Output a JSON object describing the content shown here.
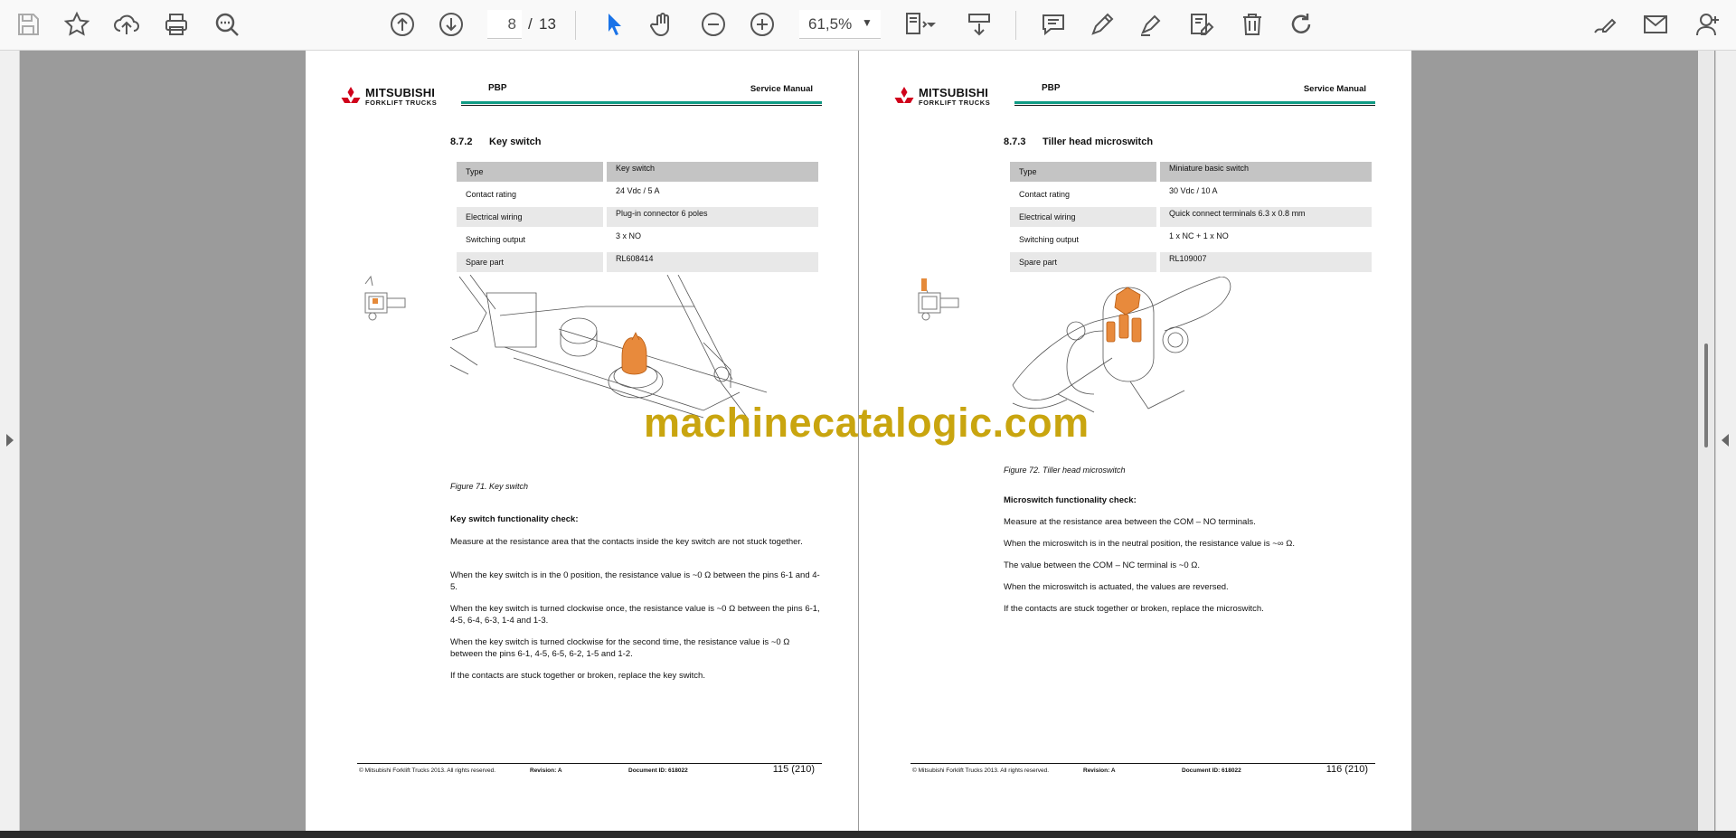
{
  "toolbar": {
    "current_page": "8",
    "page_sep": "/",
    "total_pages": "13",
    "zoom": "61,5%",
    "icons": [
      "save-icon",
      "bookmark-star-icon",
      "upload-cloud-icon",
      "print-icon",
      "zoom-search-icon",
      "prev-page-icon",
      "next-page-icon",
      "select-cursor-icon",
      "hand-tool-icon",
      "zoom-out-icon",
      "zoom-in-icon",
      "zoom-dropdown-icon",
      "fit-page-icon",
      "scroll-mode-icon",
      "comment-icon",
      "pen-icon",
      "highlight-icon",
      "stamp-icon",
      "delete-icon",
      "rotate-icon",
      "sign-icon",
      "mail-icon",
      "add-user-icon"
    ]
  },
  "watermark": "machinecatalogic.com",
  "pages": {
    "left": {
      "logo_main": "MITSUBISHI",
      "logo_sub": "FORKLIFT TRUCKS",
      "header_model": "PBP",
      "header_doc": "Service Manual",
      "section_number": "8.7.2",
      "section_title": "Key switch",
      "spec_rows": [
        {
          "k": "Type",
          "v": "Key switch"
        },
        {
          "k": "Contact rating",
          "v": "24 Vdc / 5 A"
        },
        {
          "k": "Electrical wiring",
          "v": "Plug-in connector 6 poles"
        },
        {
          "k": "Switching output",
          "v": "3 x NO"
        },
        {
          "k": "Spare part",
          "v": "RL608414"
        }
      ],
      "figure_caption": "Figure 71. Key switch",
      "check_title": "Key switch functionality check:",
      "paragraphs": [
        "Measure at the resistance area that the contacts inside the key switch are not stuck together.",
        "When the key switch is in the 0 position, the resistance value is ~0 Ω between the pins 6-1 and 4-5.",
        "When the key switch is turned clockwise once, the resistance value is ~0 Ω between the pins 6-1, 4-5, 6-4, 6-3, 1-4 and 1-3.",
        "When the key switch is turned clockwise for the second time, the resistance value is ~0 Ω between the pins 6-1, 4-5, 6-5, 6-2, 1-5 and 1-2.",
        "If the contacts are stuck together or broken, replace the key switch."
      ],
      "footer_copyright": "© Mitsubishi Forklift Trucks 2013. All rights reserved.",
      "footer_revision": "Revision: A",
      "footer_docid": "Document ID: 618022",
      "footer_page": "115 (210)"
    },
    "right": {
      "logo_main": "MITSUBISHI",
      "logo_sub": "FORKLIFT TRUCKS",
      "header_model": "PBP",
      "header_doc": "Service Manual",
      "section_number": "8.7.3",
      "section_title": "Tiller head microswitch",
      "spec_rows": [
        {
          "k": "Type",
          "v": "Miniature basic switch"
        },
        {
          "k": "Contact rating",
          "v": "30 Vdc / 10 A"
        },
        {
          "k": "Electrical wiring",
          "v": "Quick connect terminals 6.3 x 0.8 mm"
        },
        {
          "k": "Switching output",
          "v": "1 x NC + 1 x NO"
        },
        {
          "k": "Spare part",
          "v": "RL109007"
        }
      ],
      "figure_caption": "Figure 72. Tiller head microswitch",
      "check_title": "Microswitch functionality check:",
      "paragraphs": [
        "Measure at the resistance area between the COM – NO terminals.",
        "When the microswitch is in the neutral position, the resistance value is ~∞ Ω.",
        "The value between the COM – NC terminal is ~0 Ω.",
        "When the microswitch is actuated, the values are reversed.",
        "If the contacts are stuck together or broken, replace the microswitch."
      ],
      "footer_copyright": "© Mitsubishi Forklift Trucks 2013. All rights reserved.",
      "footer_revision": "Revision: A",
      "footer_docid": "Document ID: 618022",
      "footer_page": "116 (210)"
    }
  }
}
